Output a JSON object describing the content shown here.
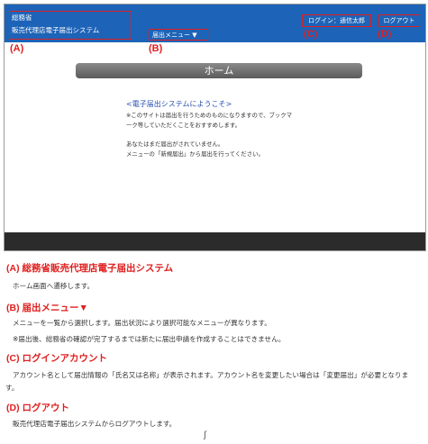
{
  "app": {
    "org_name": "総務省",
    "system_name": "販売代理店電子届出システム",
    "menu_label": "届出メニュー ▼",
    "login_account": "ログイン：通信太郎",
    "logout_label": "ログアウト"
  },
  "markers": {
    "a": "(A)",
    "b": "(B)",
    "c": "(C)",
    "d": "(D)"
  },
  "page": {
    "title": "ホーム",
    "welcome": "<電子届出システムにようこそ>",
    "notice_line1": "※このサイトは届出を行うためのものになりますので、ブックマ",
    "notice_line2": "ーク等していただくことをおすすめします。",
    "status_line1": "あなたはまだ届出がされていません。",
    "status_line2": "メニューの「新規届出」から届出を行ってください。"
  },
  "descriptions": {
    "a_title": "(A) 総務省販売代理店電子届出システム",
    "a_text": "ホーム画面へ遷移します。",
    "b_title": "(B) 届出メニュー▼",
    "b_text1": "メニューを一覧から選択します。届出状況により選択可能なメニューが異なります。",
    "b_text2": "※届出後、総務省の確認が完了するまでは新たに届出申請を作成することはできません。",
    "c_title": "(C) ログインアカウント",
    "c_text": "アカウント名として届出情報の「氏名又は名称」が表示されます。アカウント名を変更したい場合は「変更届出」が必要となります。",
    "d_title": "(D) ログアウト",
    "d_text": "販売代理店電子届出システムからログアウトします。"
  },
  "colors": {
    "header": "#1d63b7",
    "highlight": "#e02020",
    "footer": "#2b2b2b",
    "title_bar": "#6e6e6e"
  }
}
